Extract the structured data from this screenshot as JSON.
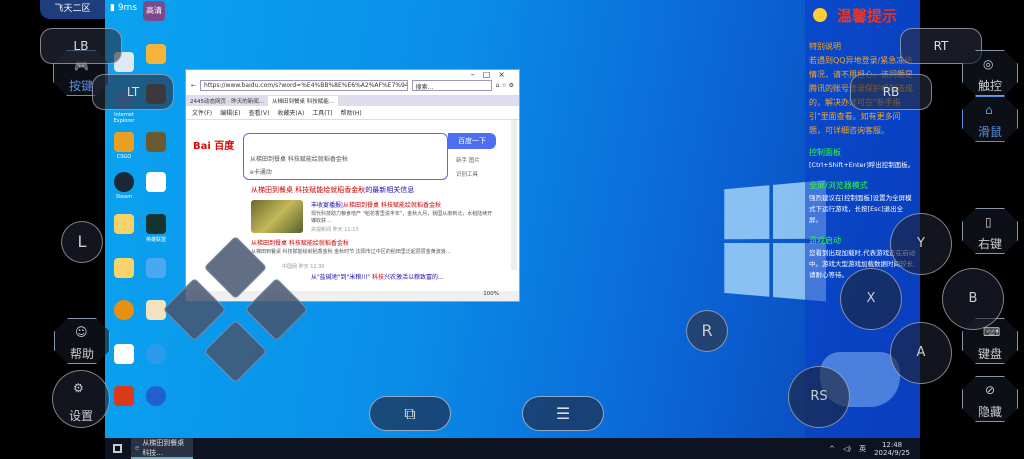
{
  "status": {
    "server": "飞天二区",
    "ping": "9ms",
    "quality": "高清"
  },
  "desktop_icons": [
    "",
    "Internet Explorer",
    "CSGO",
    "Steam",
    "",
    "",
    "",
    "",
    "",
    "英雄联盟",
    "",
    "",
    "",
    "",
    "",
    "",
    ""
  ],
  "browser": {
    "url": "https://www.baidu.com/s?word=%E4%BB%8E%E6%A2%AF%E7%94%B0...",
    "search_placeholder": "搜索...",
    "tabs": [
      "2445动态网页 · 昨天的新闻...",
      "从梯田到餐桌 科技赋能..."
    ],
    "menu": [
      "文件(F)",
      "编辑(E)",
      "查看(V)",
      "收藏夹(A)",
      "工具(T)",
      "帮助(H)"
    ],
    "logo_a": "Bai",
    "logo_b": "百度",
    "query": "从梯田到餐桌 科技赋能绘就稻香金秋",
    "suggest": "e卡通动",
    "search_button": "百度一下",
    "side_links": [
      "新手",
      "图片",
      "识别工具"
    ],
    "heading_red": "从梯田到餐桌 科技赋能绘就稻香金秋",
    "heading_blue": "的最新相关信息",
    "results": [
      {
        "title_blue": "丰收宴播报|",
        "title_red": "从梯田到餐桌 科技赋能绘就稻香金秋",
        "snippet": "现代科技助力粮食增产 \"稻花香里说丰年\"，金秋九月，我国从南到北，水稻陆续开镰收获…",
        "source": "央视新闻",
        "time": "昨天 11:13"
      },
      {
        "title_red": "从梯田到餐桌 科技赋能绘就稻香金秋",
        "snippet": "从梯田到餐桌 科技赋能绘就稻香金秋 金秋时节 沈阳市辽中区的稻田里泛起层层金黄波浪…",
        "source": "中国网",
        "time": "昨天 12:30"
      },
      {
        "title_blue": "从\"盐碱地\"到\"米粮川\" ",
        "title_red": "科技",
        "title_rest": "兴农激活以粮致富的..."
      }
    ],
    "zoom": "100%"
  },
  "taskbar": {
    "app": "从梯田到餐桌 科技...",
    "ime": "英",
    "time": "12:48",
    "date": "2024/9/25"
  },
  "controls": {
    "lb": "LB",
    "lt": "LT",
    "rt": "RT",
    "rb": "RB",
    "l": "L",
    "r": "R",
    "rs": "RS",
    "x": "X",
    "y": "Y",
    "a": "A",
    "b": "B",
    "keys": "按键",
    "touch": "触控",
    "mouse": "滑鼠",
    "right_click": "右键",
    "keyboard": "键盘",
    "hide": "隐藏",
    "help": "帮助",
    "settings": "设置"
  },
  "tips": {
    "title": "温馨提示",
    "s1_title": "特别说明",
    "s1_body": "若遇到QQ异地登录/紧急冻结情况，请不用担心，该问题是腾讯的账号登录保护机制造成的，解决办法可在\"新手指引\"里面查看。如有更多问题，可详细咨询客服。",
    "s2_title": "控制面板",
    "s2_body": "[Ctrl+Shift+Enter]呼出控制面板。",
    "s3_title": "全屏/浏览器模式",
    "s3_body": "强烈建议在[控制面板]设置为全屏模式下运行游戏，长按[Esc]退出全屏。",
    "s4_title": "游戏启动",
    "s4_body": "您看到出现加载时,代表游戏正在启动中。游戏大型游戏加载数据时间较长,请耐心等待。"
  }
}
